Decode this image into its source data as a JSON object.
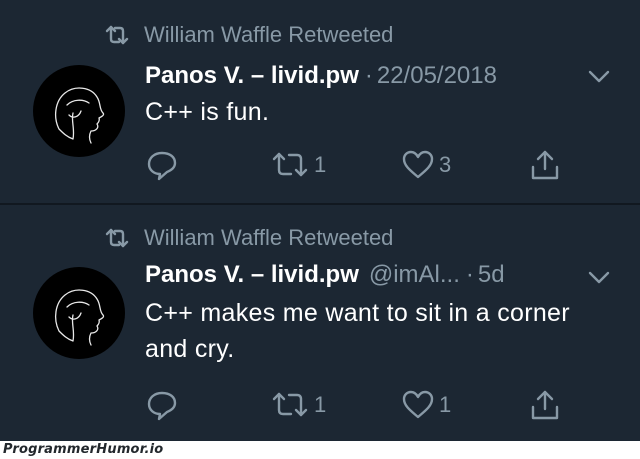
{
  "tweets": [
    {
      "retweeted_by": "William Waffle Retweeted",
      "author_name": "Panos V. – livid.pw",
      "handle": "",
      "separator": "·",
      "date": "22/05/2018",
      "text": "C++ is fun.",
      "retweet_count": "1",
      "like_count": "3",
      "reply_count": ""
    },
    {
      "retweeted_by": "William Waffle Retweeted",
      "author_name": "Panos V. – livid.pw",
      "handle": "@imAl...",
      "separator": "·",
      "date": "5d",
      "text": "C++ makes me want to sit in a corner and cry.",
      "retweet_count": "1",
      "like_count": "1",
      "reply_count": ""
    }
  ],
  "footer": {
    "watermark": "ProgrammerHumor.io"
  },
  "icons": {
    "retweet_header": "retweet-icon",
    "reply": "reply-icon",
    "retweet": "retweet-icon",
    "like": "heart-icon",
    "share": "share-icon",
    "menu": "chevron-down-icon"
  },
  "colors": {
    "background": "#1c2733",
    "text": "#ffffff",
    "muted": "#8899a6",
    "separator": "#111820"
  }
}
